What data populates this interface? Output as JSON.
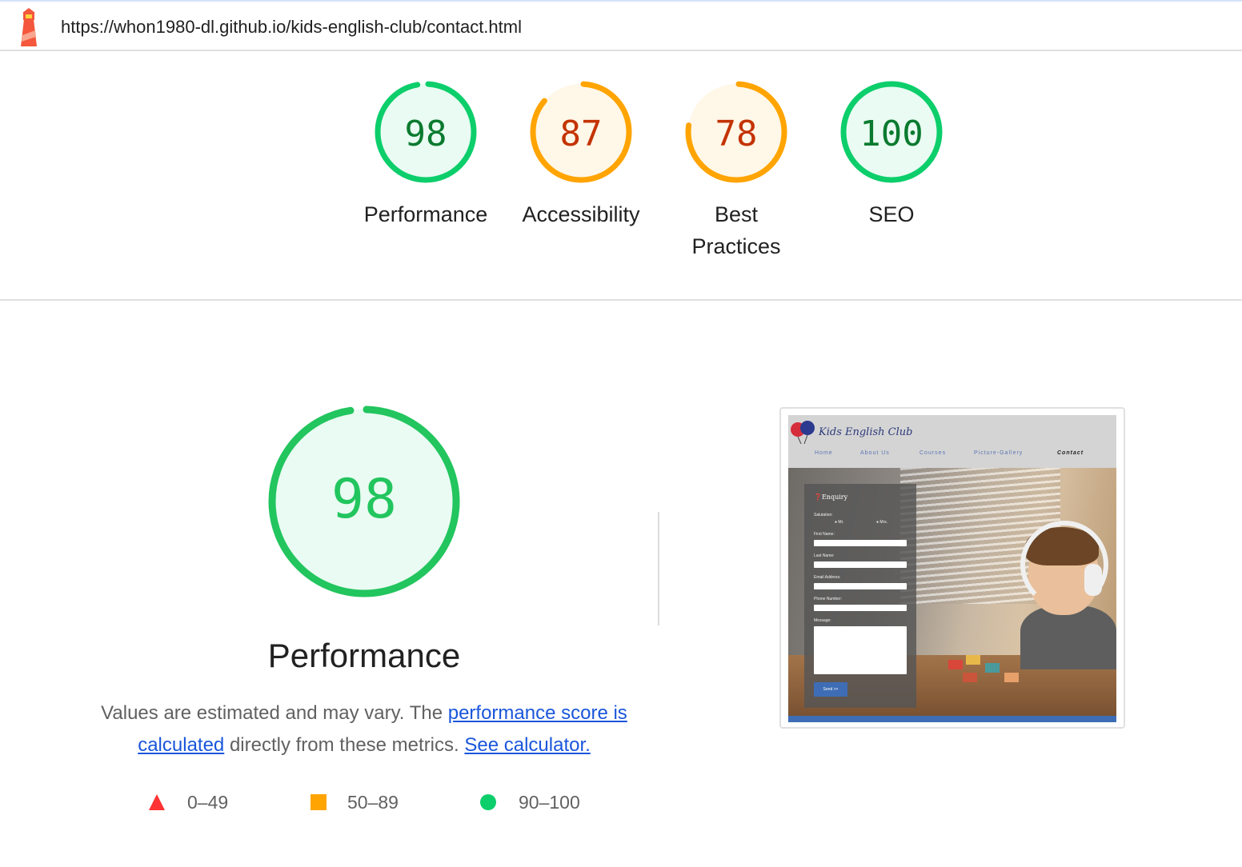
{
  "header": {
    "url": "https://whon1980-dl.github.io/kids-english-club/contact.html",
    "logo_icon": "lighthouse-icon"
  },
  "colors": {
    "pass": "#0cce6b",
    "pass_text": "#0a7a2f",
    "average": "#ffa400",
    "average_text": "#c33300",
    "fail": "#ff3333",
    "link": "#1a56db"
  },
  "gauges": [
    {
      "label": "Performance",
      "score": "98",
      "value": 98,
      "rating": "pass"
    },
    {
      "label": "Accessibility",
      "score": "87",
      "value": 87,
      "rating": "average"
    },
    {
      "label": "Best Practices",
      "score": "78",
      "value": 78,
      "rating": "average"
    },
    {
      "label": "SEO",
      "score": "100",
      "value": 100,
      "rating": "pass"
    }
  ],
  "performance": {
    "score": "98",
    "value": 98,
    "title": "Performance",
    "desc_pre": "Values are estimated and may vary. The ",
    "desc_link1": "performance score is calculated",
    "desc_mid": " directly from these metrics. ",
    "desc_link2": "See calculator."
  },
  "legend": [
    {
      "icon": "triangle-icon",
      "range": "0–49"
    },
    {
      "icon": "square-icon",
      "range": "50–89"
    },
    {
      "icon": "circle-icon",
      "range": "90–100"
    }
  ],
  "screenshot": {
    "brand": "Kids English Club",
    "nav": [
      "Home",
      "About Us",
      "Courses",
      "Picture-Gallery",
      "Contact"
    ],
    "form_title": "Enquiry",
    "salutation_label": "Salutation:",
    "opt_mr": "Mr.",
    "opt_mrs": "Mrs.",
    "first_name": "First Name:",
    "last_name": "Last Name:",
    "email": "Email Address:",
    "phone": "Phone Number:",
    "message": "Message:",
    "send": "Send >>"
  }
}
